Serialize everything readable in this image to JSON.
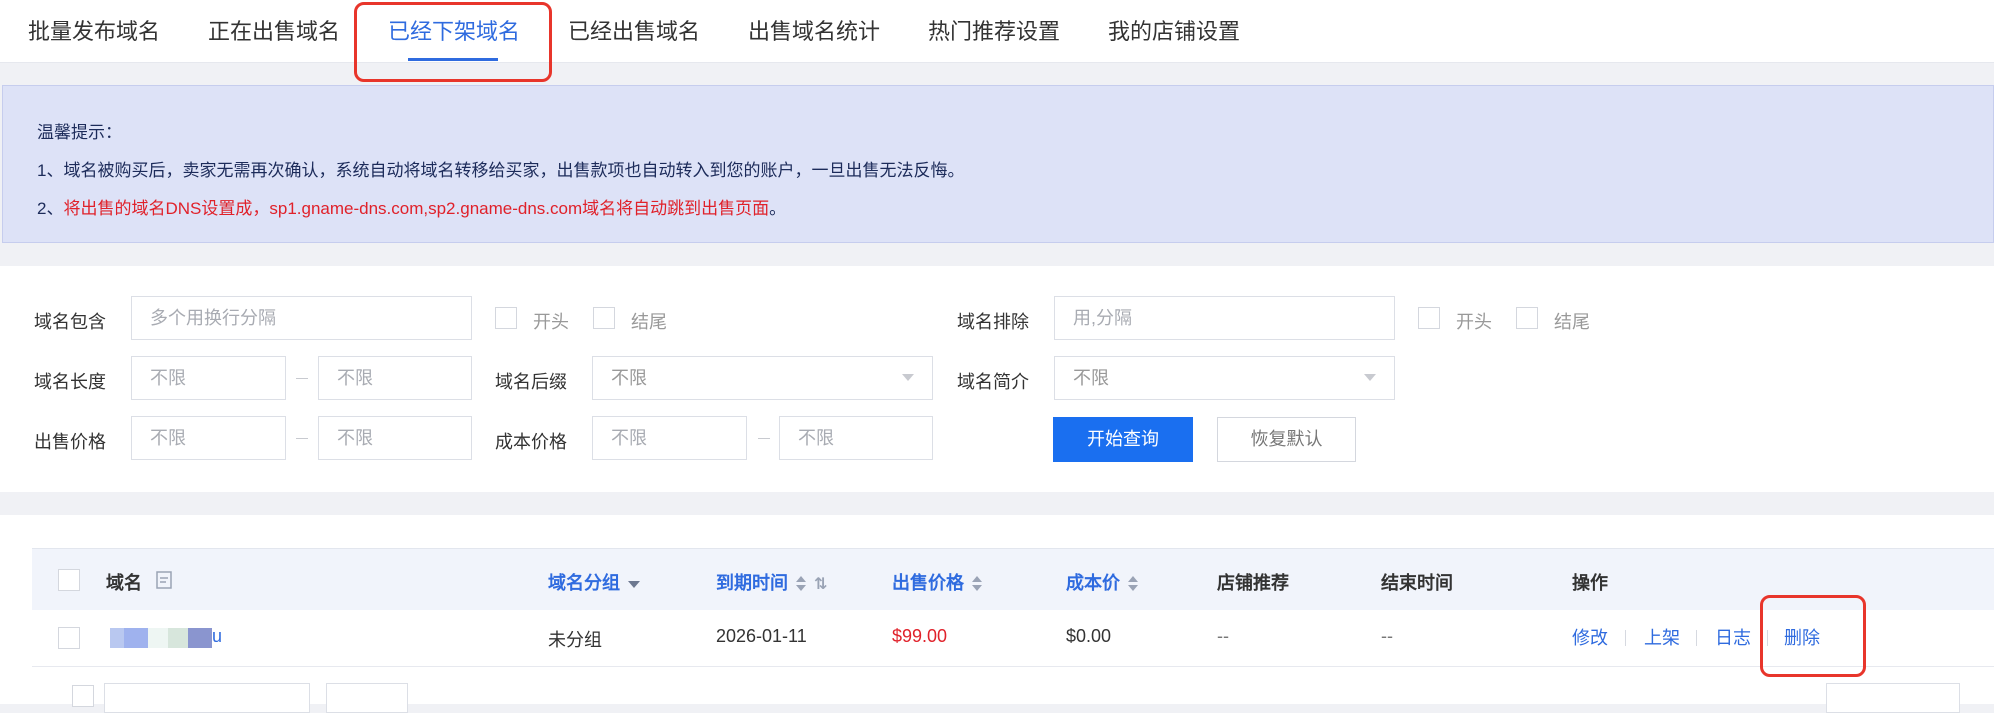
{
  "tabs": [
    {
      "label": "批量发布域名"
    },
    {
      "label": "正在出售域名"
    },
    {
      "label": "已经下架域名",
      "active": true
    },
    {
      "label": "已经出售域名"
    },
    {
      "label": "出售域名统计"
    },
    {
      "label": "热门推荐设置"
    },
    {
      "label": "我的店铺设置"
    }
  ],
  "notice": {
    "title": "温馨提示：",
    "line1": "1、域名被购买后，卖家无需再次确认，系统自动将域名转移给买家，出售款项也自动转入到您的账户，一旦出售无法反悔。",
    "line2_prefix": "2、",
    "line2_red": "将出售的域名DNS设置成，sp1.gname-dns.com,sp2.gname-dns.com域名将自动跳到出售页面",
    "line2_suffix": "。"
  },
  "filters": {
    "contains": {
      "label": "域名包含",
      "placeholder": "多个用换行分隔",
      "start": "开头",
      "end": "结尾"
    },
    "exclude": {
      "label": "域名排除",
      "placeholder": "用,分隔",
      "start": "开头",
      "end": "结尾"
    },
    "length": {
      "label": "域名长度",
      "min_placeholder": "不限",
      "max_placeholder": "不限"
    },
    "suffix": {
      "label": "域名后缀",
      "value": "不限"
    },
    "intro": {
      "label": "域名简介",
      "value": "不限"
    },
    "sale_price": {
      "label": "出售价格",
      "min_placeholder": "不限",
      "max_placeholder": "不限"
    },
    "cost_price": {
      "label": "成本价格",
      "min_placeholder": "不限",
      "max_placeholder": "不限"
    },
    "search_button": "开始查询",
    "reset_button": "恢复默认"
  },
  "table": {
    "headers": {
      "domain": "域名",
      "group": "域名分组",
      "expire": "到期时间",
      "sale_price": "出售价格",
      "cost": "成本价",
      "recommend": "店铺推荐",
      "end_time": "结束时间",
      "ops": "操作"
    },
    "rows": [
      {
        "domain_suffix": "u",
        "group": "未分组",
        "expire": "2026-01-11",
        "sale_price": "$99.00",
        "cost": "$0.00",
        "recommend": "--",
        "end_time": "--",
        "actions": [
          "修改",
          "上架",
          "日志",
          "删除"
        ]
      }
    ]
  },
  "colors": {
    "accent": "#2f6bdf",
    "primary_button": "#1a6ff0",
    "price_red": "#e0212a",
    "highlight_box": "#e8352b",
    "notice_bg": "#dde2f7"
  }
}
